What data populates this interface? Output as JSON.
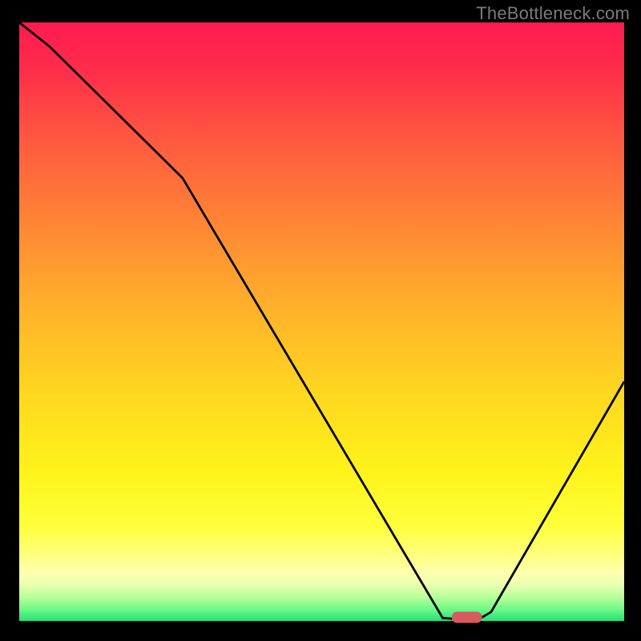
{
  "watermark": "TheBottleneck.com",
  "chart_data": {
    "type": "line",
    "title": "",
    "xlabel": "",
    "ylabel": "",
    "xlim": [
      0,
      100
    ],
    "ylim": [
      0,
      100
    ],
    "x": [
      0,
      5,
      27,
      70,
      72.5,
      76,
      78,
      100
    ],
    "y": [
      100,
      96,
      74,
      0.5,
      0.3,
      0.3,
      1.5,
      40
    ],
    "marker": {
      "x": 74,
      "y": 0.6
    },
    "background": "heat-gradient-red-to-green",
    "grid": false,
    "border": true
  }
}
